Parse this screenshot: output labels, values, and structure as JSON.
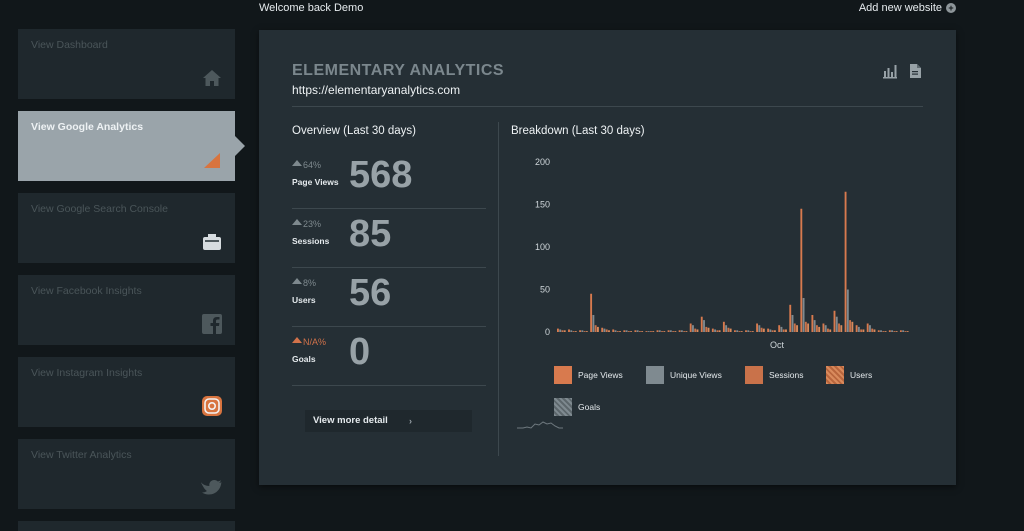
{
  "header": {
    "welcome": "Welcome back Demo",
    "add_site": "Add new website"
  },
  "sidebar": {
    "items": [
      {
        "label": "View Dashboard",
        "icon": "home-icon",
        "active": false
      },
      {
        "label": "View Google Analytics",
        "icon": "analytics-icon",
        "active": true
      },
      {
        "label": "View Google Search Console",
        "icon": "search-console-icon",
        "active": false
      },
      {
        "label": "View Facebook Insights",
        "icon": "facebook-icon",
        "active": false
      },
      {
        "label": "View Instagram Insights",
        "icon": "instagram-icon",
        "active": false
      },
      {
        "label": "View Twitter Analytics",
        "icon": "twitter-icon",
        "active": false
      }
    ]
  },
  "panel": {
    "title": "ELEMENTARY ANALYTICS",
    "url": "https://elementaryanalytics.com",
    "icons": [
      "bar-chart-export-icon",
      "pdf-export-icon"
    ]
  },
  "overview": {
    "title": "Overview (Last 30 days)",
    "stats": [
      {
        "pct": "64%",
        "name": "Page Views",
        "value": "568",
        "na": false
      },
      {
        "pct": "23%",
        "name": "Sessions",
        "value": "85",
        "na": false
      },
      {
        "pct": "8%",
        "name": "Users",
        "value": "56",
        "na": false
      },
      {
        "pct": "N/A%",
        "name": "Goals",
        "value": "0",
        "na": true
      }
    ],
    "more_label": "View more detail",
    "more_arrow": "›"
  },
  "breakdown": {
    "title": "Breakdown (Last 30 days)",
    "legend": [
      "Page Views",
      "Unique Views",
      "Sessions",
      "Users",
      "Goals"
    ]
  },
  "colors": {
    "page_views": "#d87a4e",
    "unique_views": "#7f8a90",
    "sessions": "#c9724a",
    "users": "#d98a5c",
    "goals": "#6f797f"
  },
  "chart_data": {
    "type": "bar",
    "ylim": [
      0,
      200
    ],
    "yticks": [
      "0",
      "50",
      "100",
      "150",
      "200"
    ],
    "xlabel": "",
    "ylabel": "",
    "x_tick_label": "Oct",
    "series": [
      {
        "name": "Page Views",
        "values": [
          4,
          3,
          2,
          45,
          5,
          3,
          2,
          2,
          1,
          2,
          2,
          2,
          10,
          18,
          4,
          12,
          2,
          2,
          10,
          4,
          8,
          32,
          145,
          20,
          10,
          25,
          165,
          8,
          10,
          2,
          2,
          2
        ]
      },
      {
        "name": "Unique Views",
        "values": [
          3,
          2,
          2,
          20,
          4,
          2,
          2,
          2,
          1,
          2,
          2,
          2,
          8,
          14,
          3,
          8,
          2,
          2,
          8,
          3,
          6,
          20,
          40,
          14,
          8,
          18,
          50,
          6,
          8,
          2,
          2,
          2
        ]
      },
      {
        "name": "Sessions",
        "values": [
          2,
          1,
          1,
          8,
          3,
          1,
          1,
          1,
          1,
          1,
          1,
          1,
          4,
          6,
          2,
          5,
          1,
          1,
          5,
          2,
          3,
          10,
          12,
          8,
          4,
          10,
          14,
          3,
          4,
          1,
          1,
          1
        ]
      },
      {
        "name": "Users",
        "values": [
          2,
          1,
          1,
          6,
          2,
          1,
          1,
          1,
          1,
          1,
          1,
          1,
          3,
          5,
          2,
          4,
          1,
          1,
          4,
          2,
          3,
          8,
          10,
          6,
          3,
          8,
          12,
          3,
          3,
          1,
          1,
          1
        ]
      },
      {
        "name": "Goals",
        "values": [
          0,
          0,
          0,
          0,
          0,
          0,
          0,
          0,
          0,
          0,
          0,
          0,
          0,
          0,
          0,
          0,
          0,
          0,
          0,
          0,
          0,
          0,
          0,
          0,
          0,
          0,
          0,
          0,
          0,
          0,
          0,
          0
        ]
      }
    ]
  }
}
